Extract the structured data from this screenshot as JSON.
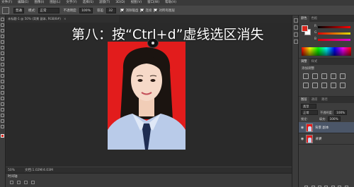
{
  "menu": [
    "文件(F)",
    "编辑(E)",
    "图像(I)",
    "图层(L)",
    "文字(Y)",
    "选择(S)",
    "滤镜(T)",
    "3D(D)",
    "视图(V)",
    "窗口(W)",
    "帮助(H)"
  ],
  "options": {
    "mode_value": "普通",
    "style_label": "模式:",
    "style_value": "正常",
    "opacity_label": "不透明度:",
    "opacity_value": "100%",
    "tolerance_label": "容差:",
    "tolerance_value": "32",
    "anti_alias_label": "消除锯齿",
    "contiguous_label": "连续",
    "sample_all_label": "对所有图层"
  },
  "document": {
    "tab_title": "未标题-1 @ 50% (背景 副本, RGB/8#)",
    "close_glyph": "×",
    "zoom": "50%",
    "doc_info": "文档:1.02M/4.03M"
  },
  "caption": "第八：按“Ctrl+d”虚线选区消失",
  "timeline": {
    "label": "时间轴"
  },
  "panels": {
    "color_tabs": [
      "颜色",
      "色板"
    ],
    "channels": [
      "R",
      "G",
      "B"
    ],
    "adjust_tabs": [
      "调整",
      "样式"
    ],
    "adjust_title": "添加调整",
    "layer_tabs": [
      "图层",
      "通道",
      "路径"
    ],
    "kind_label": "类型",
    "blend_mode": "正常",
    "opacity_label": "不透明度:",
    "opacity_value": "100%",
    "lock_label": "锁定:",
    "fill_label": "填充:",
    "fill_value": "100%",
    "layers": [
      {
        "name": "背景 副本",
        "selected": true
      },
      {
        "name": "背景",
        "selected": false
      }
    ],
    "visibility_glyph": "◉"
  },
  "colors": {
    "foreground": "#d9251b",
    "background": "#ffffff",
    "photo_background": "#e21c1c",
    "selected_layer": "#4b5668"
  }
}
